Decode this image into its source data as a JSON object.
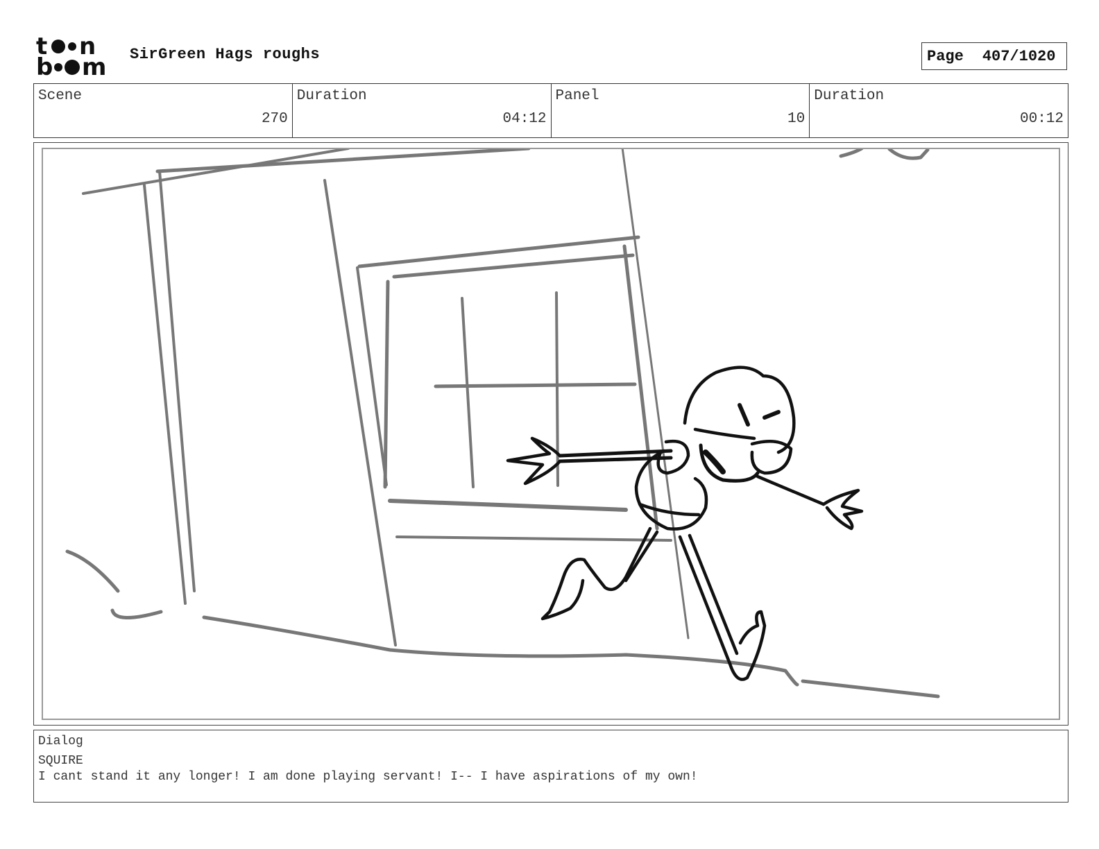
{
  "header": {
    "logo_text": "toonboom",
    "title": "SirGreen Hags roughs",
    "page_label": "Page",
    "page_value": "407/1020"
  },
  "info": {
    "scene_label": "Scene",
    "scene_value": "270",
    "scene_duration_label": "Duration",
    "scene_duration_value": "04:12",
    "panel_label": "Panel",
    "panel_value": "10",
    "panel_duration_label": "Duration",
    "panel_duration_value": "00:12"
  },
  "dialog": {
    "label": "Dialog",
    "speaker": "SQUIRE",
    "line": "I cant stand it any longer! I am done playing servant! I-- I have aspirations of my own!"
  }
}
